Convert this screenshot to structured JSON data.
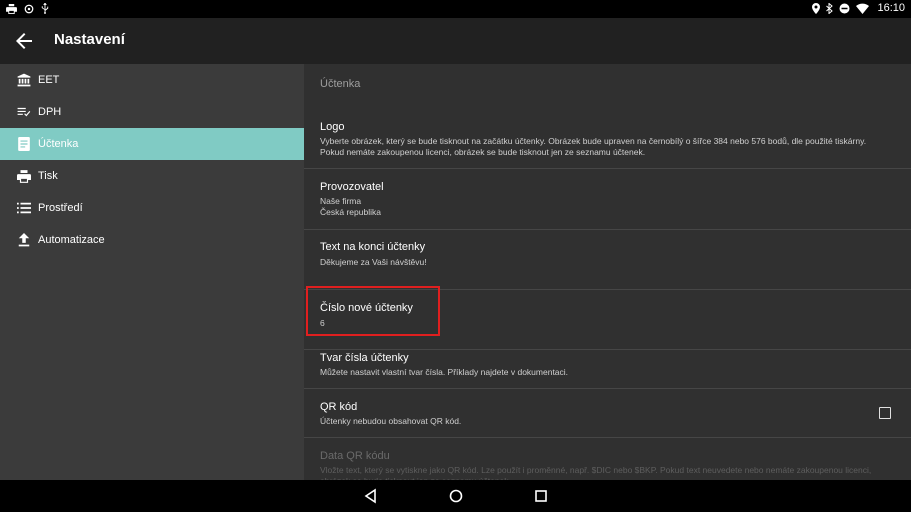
{
  "status": {
    "time": "16:10",
    "left_icons": [
      "print-icon",
      "settings-icon",
      "usb-icon"
    ],
    "right_icons": [
      "location-icon",
      "bluetooth-icon",
      "dnd-icon",
      "wifi-icon"
    ]
  },
  "appbar": {
    "title": "Nastavení"
  },
  "sidebar": {
    "items": [
      {
        "label": "EET",
        "icon": "bank-icon"
      },
      {
        "label": "DPH",
        "icon": "list-check-icon"
      },
      {
        "label": "Účtenka",
        "icon": "receipt-icon"
      },
      {
        "label": "Tisk",
        "icon": "print-icon"
      },
      {
        "label": "Prostředí",
        "icon": "list-icon"
      },
      {
        "label": "Automatizace",
        "icon": "upload-icon"
      }
    ]
  },
  "content": {
    "section_title": "Účtenka",
    "prefs": [
      {
        "title": "Logo",
        "summary": "Vyberte obrázek, který se bude tisknout na začátku účtenky. Obrázek bude upraven na černobílý o šířce 384 nebo 576 bodů, dle použité tiskárny. Pokud nemáte zakoupenou licenci, obrázek se bude tisknout jen ze seznamu účtenek."
      },
      {
        "title": "Provozovatel",
        "summary": "Naše firma",
        "summary2": "Česká republika"
      },
      {
        "title": "Text na konci účtenky",
        "summary": "Děkujeme za Vaši návštěvu!"
      },
      {
        "title": "Číslo nové účtenky",
        "summary": "6"
      },
      {
        "title": "Tvar čísla účtenky",
        "summary": "Můžete nastavit vlastní tvar čísla. Příklady najdete v dokumentaci."
      },
      {
        "title": "QR kód",
        "summary": "Účtenky nebudou obsahovat QR kód.",
        "checked": false
      },
      {
        "title": "Data QR kódu",
        "summary": "Vložte text, který se vytiskne jako QR kód. Lze použít i proměnné, např. $DIC nebo $BKP. Pokud text neuvedete nebo nemáte zakoupenou licenci, obrázek se bude tisknout jen ze seznamu účtenek."
      }
    ]
  },
  "colors": {
    "accent": "#80cbc4",
    "highlight": "#e01f1f"
  }
}
